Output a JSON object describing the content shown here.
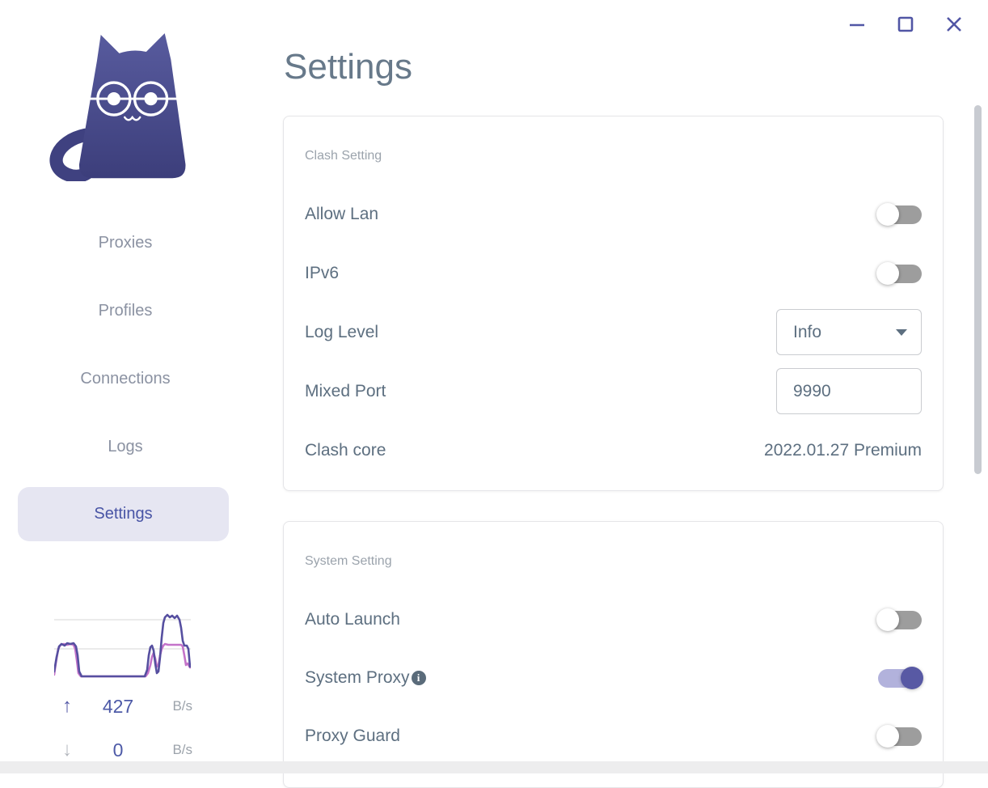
{
  "window": {
    "controls": {
      "minimize": "minimize",
      "maximize": "maximize",
      "close": "close"
    }
  },
  "header": {
    "title": "Settings"
  },
  "sidebar": {
    "nav": [
      {
        "label": "Proxies",
        "active": false
      },
      {
        "label": "Profiles",
        "active": false
      },
      {
        "label": "Connections",
        "active": false
      },
      {
        "label": "Logs",
        "active": false
      },
      {
        "label": "Settings",
        "active": true
      }
    ],
    "traffic": {
      "upload": {
        "value": "427",
        "unit": "B/s"
      },
      "download": {
        "value": "0",
        "unit": "B/s"
      },
      "graph": {
        "type": "line",
        "series": [
          {
            "name": "upload",
            "color": "#564fa0"
          },
          {
            "name": "download",
            "color": "#c473c9"
          }
        ]
      }
    }
  },
  "cards": [
    {
      "section": "Clash Setting",
      "rows": [
        {
          "label": "Allow Lan",
          "control": "toggle",
          "on": false
        },
        {
          "label": "IPv6",
          "control": "toggle",
          "on": false
        },
        {
          "label": "Log Level",
          "control": "select",
          "value": "Info"
        },
        {
          "label": "Mixed Port",
          "control": "input",
          "value": "9990"
        },
        {
          "label": "Clash core",
          "control": "text",
          "value": "2022.01.27 Premium"
        }
      ]
    },
    {
      "section": "System Setting",
      "rows": [
        {
          "label": "Auto Launch",
          "control": "toggle",
          "on": false
        },
        {
          "label": "System Proxy",
          "control": "toggle",
          "on": true,
          "info": true
        },
        {
          "label": "Proxy Guard",
          "control": "toggle",
          "on": false
        }
      ]
    }
  ],
  "colors": {
    "accent": "#5156a5",
    "nav_active_bg": "#e6e6f2",
    "toggle_off_track": "#9d9d9d",
    "toggle_on_track": "#b2b2dc",
    "toggle_on_thumb": "#5859a4",
    "graph_upload": "#564fa0",
    "graph_download": "#c473c9"
  }
}
